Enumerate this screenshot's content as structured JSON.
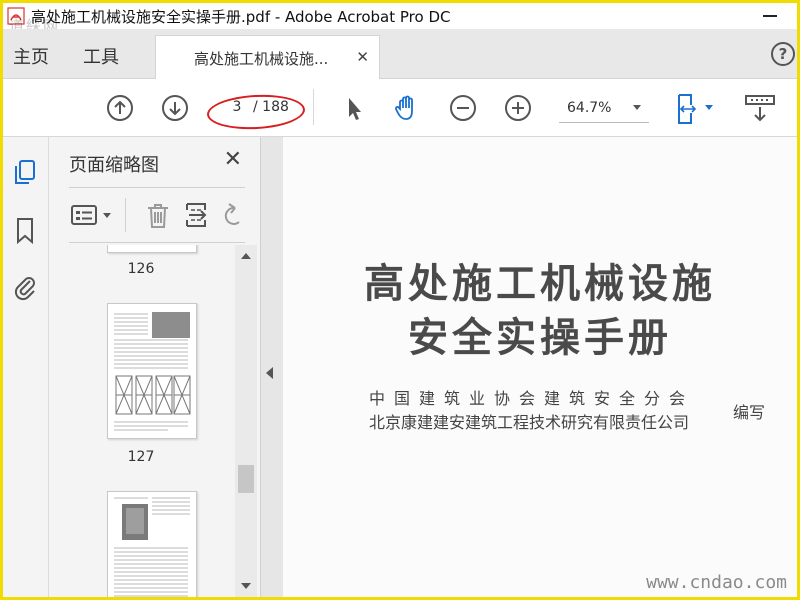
{
  "window": {
    "title": "高处施工机械设施安全实操手册.pdf - Adobe Acrobat Pro DC",
    "watermark_top": "道綵网"
  },
  "menu": {
    "home": "主页",
    "tools": "工具",
    "document_tab": "高处施工机械设施...",
    "help_label": "?"
  },
  "toolbar": {
    "current_page": "3",
    "total_pages": "/ 188",
    "zoom": "64.7%",
    "annotation_color": "#d81e1e"
  },
  "thumbnails_panel": {
    "title": "页面缩略图",
    "pages": [
      {
        "label": "126"
      },
      {
        "label": "127"
      },
      {
        "label": ""
      }
    ]
  },
  "document": {
    "title_line1": "高处施工机械设施",
    "title_line2": "安全实操手册",
    "author_line1": "中国建筑业协会建筑安全分会",
    "author_line2": "北京康建建安建筑工程技术研究有限责任公司",
    "compiled": "编写"
  },
  "watermark": "www.cndao.com"
}
